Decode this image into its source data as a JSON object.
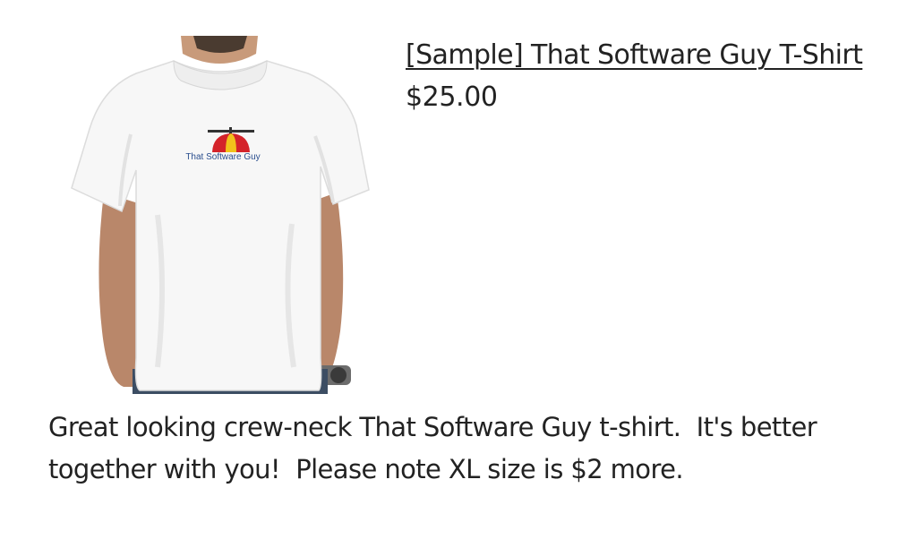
{
  "product": {
    "title": "[Sample] That Software Guy T-Shirt",
    "price": "$25.00",
    "description": "Great looking crew-neck That Software Guy t-shirt.  It's better\ntogether with you!  Please note XL size is $2 more.",
    "image": {
      "shirt_logo_text": "That Software Guy",
      "shirt_color": "#ffffff",
      "logo_colors": [
        "#d4232a",
        "#f2c21b",
        "#2a4e8e"
      ]
    }
  }
}
